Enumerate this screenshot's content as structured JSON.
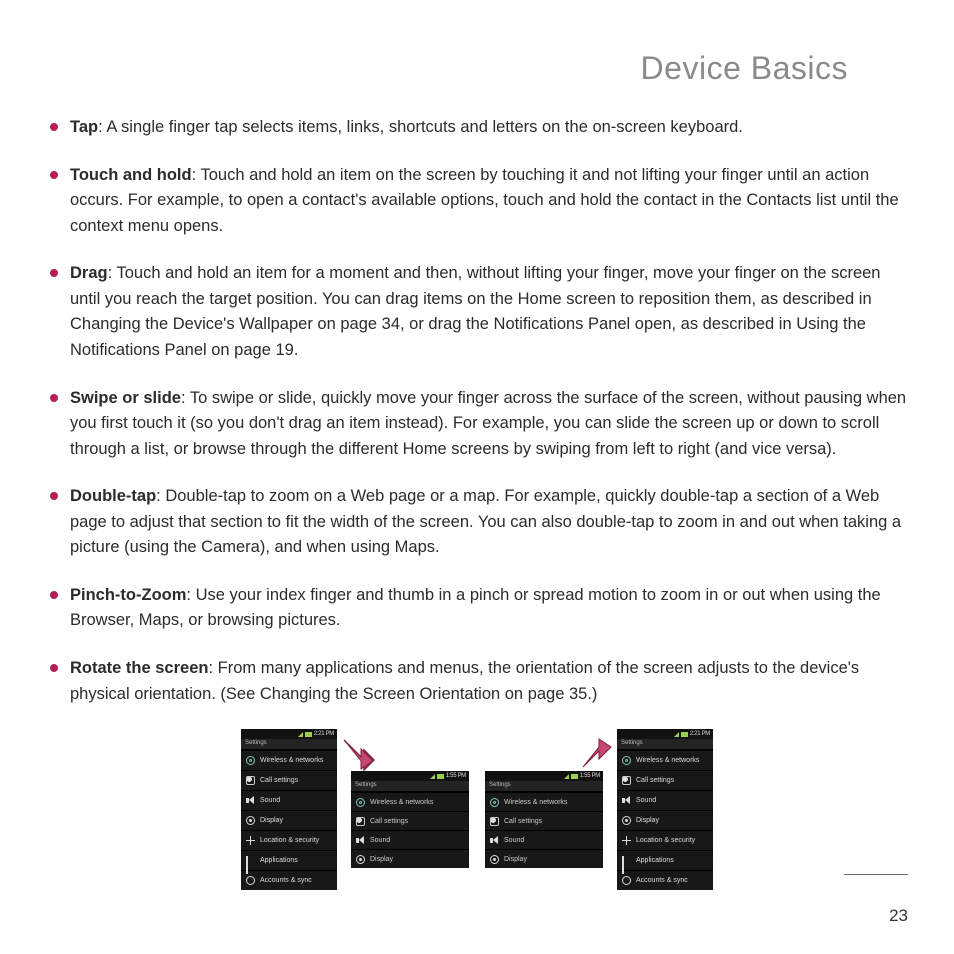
{
  "title": "Device Basics",
  "page_number": "23",
  "colors": {
    "bullet": "#b41f56",
    "arrow": "#c54772"
  },
  "gestures": [
    {
      "term": "Tap",
      "text": ": A single finger tap selects items, links, shortcuts and letters on the on-screen keyboard."
    },
    {
      "term": "Touch and hold",
      "text": ": Touch and hold an item on the screen by touching it and not lifting your finger until an action occurs. For example, to open a contact's available options, touch and hold the contact in the Contacts list until the context menu opens."
    },
    {
      "term": "Drag",
      "text": ": Touch and hold an item for a moment and then, without lifting your finger, move your finger on the screen until you reach the target position. You can drag items on the Home screen to reposition them, as described in Changing the Device's Wallpaper on page 34, or drag the Notifications Panel open, as described in Using the Notifications Panel on page 19."
    },
    {
      "term": "Swipe or slide",
      "text": ": To swipe or slide, quickly move your finger across the surface of the screen, without pausing when you first touch it (so you don't drag an item instead). For example, you can slide the screen up or down to scroll through a list, or browse through the different Home screens by swiping from left to right (and vice versa)."
    },
    {
      "term": "Double-tap",
      "text": ": Double-tap to zoom on a Web page or a map. For example, quickly double-tap a section of a Web page to adjust that section to fit the width of the screen. You can also double-tap to zoom in and out when taking a picture (using the Camera), and when using Maps."
    },
    {
      "term": "Pinch-to-Zoom",
      "text": ": Use your index finger and thumb in a pinch or spread motion to zoom in or out when using the Browser, Maps, or browsing pictures."
    },
    {
      "term": "Rotate the screen",
      "text": ": From many applications and menus, the orientation of the screen adjusts to the device's physical orientation. (See Changing the Screen Orientation on page 35.)"
    }
  ],
  "phone_time_a": "2:21 PM",
  "phone_time_b": "1:55 PM",
  "phone_header": "Settings",
  "menu_full": [
    {
      "icon": "wifi",
      "label": "Wireless & networks"
    },
    {
      "icon": "call",
      "label": "Call settings"
    },
    {
      "icon": "sound",
      "label": "Sound"
    },
    {
      "icon": "display",
      "label": "Display"
    },
    {
      "icon": "loc",
      "label": "Location & security"
    },
    {
      "icon": "apps",
      "label": "Applications"
    },
    {
      "icon": "acct",
      "label": "Accounts & sync"
    }
  ],
  "menu_short": [
    {
      "icon": "wifi",
      "label": "Wireless & networks"
    },
    {
      "icon": "call",
      "label": "Call settings"
    },
    {
      "icon": "sound",
      "label": "Sound"
    },
    {
      "icon": "display",
      "label": "Display"
    }
  ]
}
